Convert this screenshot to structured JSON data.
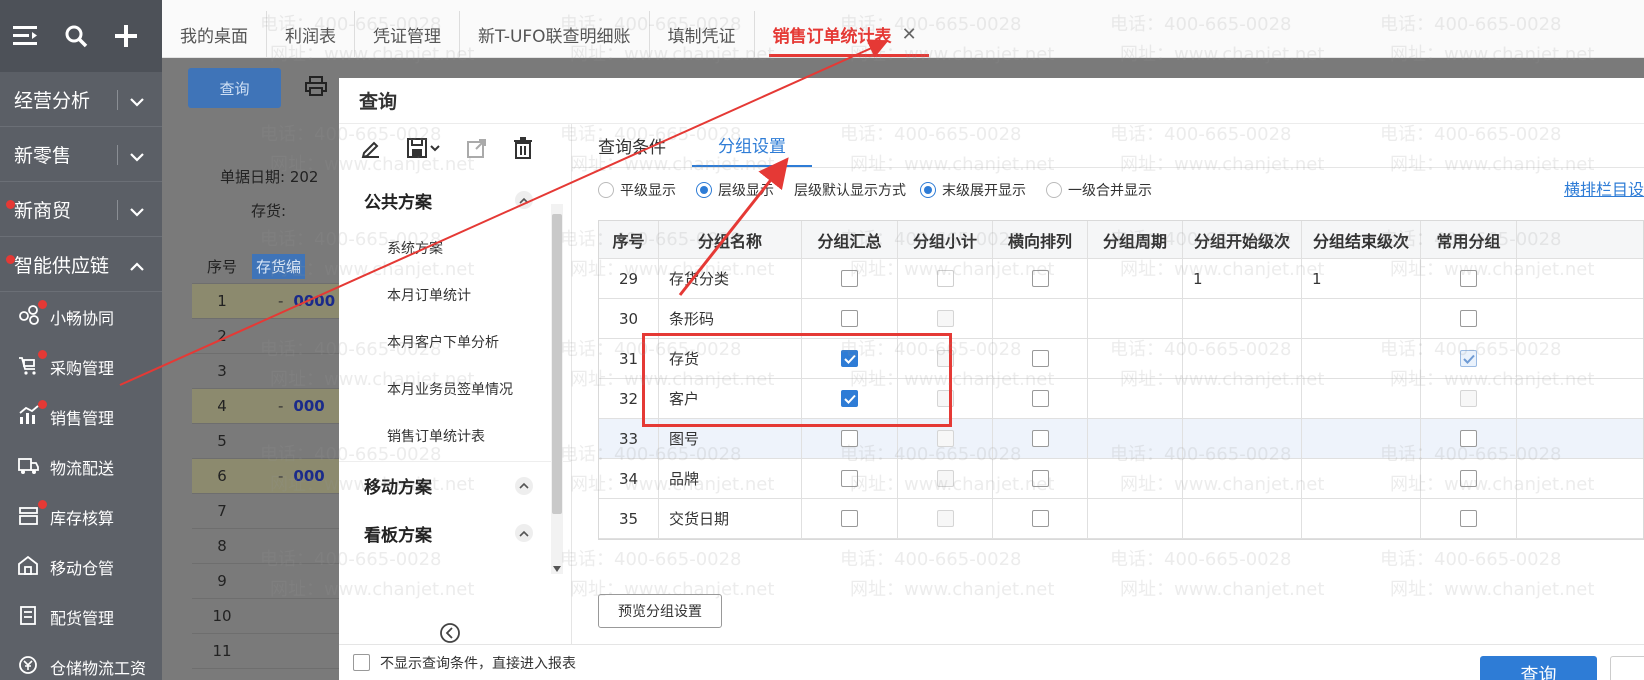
{
  "sidebar": {
    "categories": [
      {
        "label": "经营分析",
        "expanded": false,
        "badge": false
      },
      {
        "label": "新零售",
        "expanded": false,
        "badge": false
      },
      {
        "label": "新商贸",
        "expanded": false,
        "badge": true
      },
      {
        "label": "智能供应链",
        "expanded": true,
        "badge": true
      }
    ],
    "items": [
      {
        "label": "小畅协同",
        "icon": "collaboration-icon",
        "badge": true
      },
      {
        "label": "采购管理",
        "icon": "cart-icon",
        "badge": true
      },
      {
        "label": "销售管理",
        "icon": "sales-chart-icon",
        "badge": true
      },
      {
        "label": "物流配送",
        "icon": "truck-icon",
        "badge": false
      },
      {
        "label": "库存核算",
        "icon": "inventory-icon",
        "badge": true
      },
      {
        "label": "移动仓管",
        "icon": "mobile-warehouse-icon",
        "badge": false
      },
      {
        "label": "配货管理",
        "icon": "distribution-icon",
        "badge": false
      },
      {
        "label": "仓储物流工资",
        "icon": "wage-icon",
        "badge": false
      }
    ]
  },
  "tabs": [
    {
      "label": "我的桌面",
      "active": false
    },
    {
      "label": "利润表",
      "active": false
    },
    {
      "label": "凭证管理",
      "active": false
    },
    {
      "label": "新T-UFO联查明细账",
      "active": false
    },
    {
      "label": "填制凭证",
      "active": false
    },
    {
      "label": "销售订单统计表",
      "active": true
    }
  ],
  "background": {
    "query_button": "查询",
    "date_label": "单据日期:",
    "date_value": "202",
    "inventory_label": "存货:",
    "col_seq": "序号",
    "col_code": "存货编",
    "rows": [
      {
        "n": "1",
        "code": "0000"
      },
      {
        "n": "2",
        "code": ""
      },
      {
        "n": "3",
        "code": ""
      },
      {
        "n": "4",
        "code": "000"
      },
      {
        "n": "5",
        "code": ""
      },
      {
        "n": "6",
        "code": "000"
      },
      {
        "n": "7",
        "code": ""
      },
      {
        "n": "8",
        "code": ""
      },
      {
        "n": "9",
        "code": ""
      },
      {
        "n": "10",
        "code": ""
      },
      {
        "n": "11",
        "code": ""
      }
    ]
  },
  "dialog": {
    "title": "查询",
    "scheme_groups": {
      "public": "公共方案",
      "mobile": "移动方案",
      "board": "看板方案"
    },
    "public_items": [
      "系统方案",
      "本月订单统计",
      "本月客户下单分析",
      "本月业务员签单情况",
      "销售订单统计表"
    ],
    "subtabs": [
      "查询条件",
      "分组设置"
    ],
    "radios": {
      "flat": "平级显示",
      "tree": "层级显示",
      "default_label": "层级默认显示方式",
      "expand_last": "末级展开显示",
      "merge_first": "一级合并显示"
    },
    "layout_link": "横排栏目设",
    "columns": [
      "序号",
      "分组名称",
      "分组汇总",
      "分组小计",
      "横向排列",
      "分组周期",
      "分组开始级次",
      "分组结束级次",
      "常用分组"
    ],
    "rows": [
      {
        "seq": "29",
        "name": "存货分类",
        "sum": false,
        "sub": false,
        "horiz": false,
        "period": "",
        "start": "1",
        "end": "1",
        "common": false
      },
      {
        "seq": "30",
        "name": "条形码",
        "sum": false,
        "sub": false,
        "horiz": null,
        "period": "",
        "start": "",
        "end": "",
        "common": false
      },
      {
        "seq": "31",
        "name": "存货",
        "sum": true,
        "sub": false,
        "horiz": false,
        "period": "",
        "start": "",
        "end": "",
        "common": true
      },
      {
        "seq": "32",
        "name": "客户",
        "sum": true,
        "sub": false,
        "horiz": false,
        "period": "",
        "start": "",
        "end": "",
        "common": false
      },
      {
        "seq": "33",
        "name": "图号",
        "sum": false,
        "sub": false,
        "horiz": false,
        "period": "",
        "start": "",
        "end": "",
        "common": false
      },
      {
        "seq": "34",
        "name": "品牌",
        "sum": false,
        "sub": false,
        "horiz": false,
        "period": "",
        "start": "",
        "end": "",
        "common": false
      },
      {
        "seq": "35",
        "name": "交货日期",
        "sum": false,
        "sub": false,
        "horiz": false,
        "period": "",
        "start": "",
        "end": "",
        "common": false
      }
    ],
    "preview_button": "预览分组设置",
    "footer_checkbox": "不显示查询条件，直接进入报表",
    "footer_query": "查询"
  },
  "watermark": {
    "phone": "电话：400-665-0028",
    "site": "网址：www.chanjet.net"
  },
  "colors": {
    "accent": "#2e7cd6",
    "annotation": "#e53935",
    "sidebar": "#5b5f66"
  }
}
